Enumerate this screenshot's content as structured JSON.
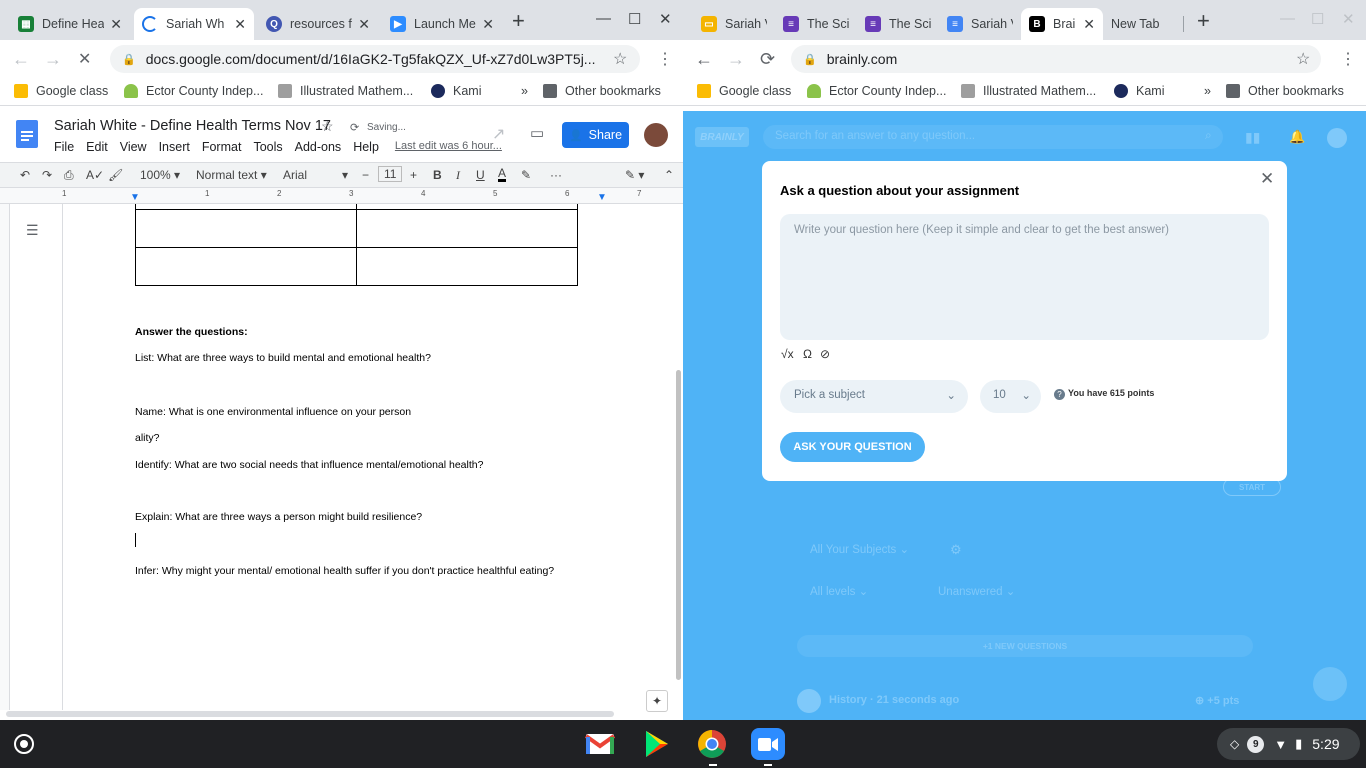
{
  "left_window": {
    "tabs": [
      {
        "title": "Define Hea",
        "icon": "sheets-icon",
        "color": "#188038"
      },
      {
        "title": "Sariah Wh",
        "icon": "loading-icon",
        "color": "#1a73e8"
      },
      {
        "title": "resources f",
        "icon": "quizlet-icon",
        "color": "#4257b2"
      },
      {
        "title": "Launch Me",
        "icon": "zoom-icon",
        "color": "#2d8cff"
      }
    ],
    "url": "docs.google.com/document/d/16IaGK2-Tg5fakQZX_Uf-xZ7d0Lw3PT5j...",
    "bookmarks": [
      "Google class",
      "Ector County Indep...",
      "Illustrated Mathem...",
      "Kami"
    ],
    "other_bookmarks": "Other bookmarks",
    "doc": {
      "title": "Sariah White - Define Health Terms Nov 17",
      "saving": "Saving...",
      "last_edit": "Last edit was 6 hour...",
      "share": "Share",
      "menu": [
        "File",
        "Edit",
        "View",
        "Insert",
        "Format",
        "Tools",
        "Add-ons",
        "Help"
      ],
      "zoom": "100%",
      "style": "Normal text",
      "font": "Arial",
      "font_size": "11",
      "ruler_numbers": [
        "1",
        "1",
        "2",
        "3",
        "4",
        "5",
        "6",
        "7"
      ],
      "heading": "Answer the questions:",
      "lines": [
        "List: What are three ways to build mental and emotional health?",
        "Name: What is one environmental influence on your person",
        "ality?",
        "Identify: What are two social needs that influence mental/emotional health?",
        "Explain: What are three ways a person might build resilience?",
        "Infer:  Why might your mental/ emotional health suffer if you don't practice healthful eating?"
      ]
    }
  },
  "right_window": {
    "tabs": [
      {
        "title": "Sariah V",
        "icon": "slides-icon",
        "color": "#f4b400"
      },
      {
        "title": "The Sci",
        "icon": "forms-icon",
        "color": "#673ab7"
      },
      {
        "title": "The Sci",
        "icon": "forms-icon",
        "color": "#673ab7"
      },
      {
        "title": "Sariah V",
        "icon": "docs-icon",
        "color": "#4285f4"
      },
      {
        "title": "Brai",
        "icon": "brainly-icon",
        "color": "#000000"
      },
      {
        "title": "New Tab",
        "icon": "",
        "color": ""
      }
    ],
    "url": "brainly.com",
    "bookmarks": [
      "Google class",
      "Ector County Indep...",
      "Illustrated Mathem...",
      "Kami"
    ],
    "other_bookmarks": "Other bookmarks",
    "brainly": {
      "logo": "BRAINLY",
      "search_placeholder": "Search for an answer to any question...",
      "modal_title": "Ask a question about your assignment",
      "question_placeholder": "Write your question here (Keep it simple and clear to get the best answer)",
      "subject_placeholder": "Pick a subject",
      "points_value": "10",
      "points_info": "You have 615 points",
      "ask_button": "ASK YOUR QUESTION",
      "start": "START",
      "filter_subjects": "All Your Subjects",
      "filter_levels": "All levels",
      "filter_status": "Unanswered",
      "new_questions": "+1 NEW QUESTIONS",
      "feed_subject": "History · 21 seconds ago",
      "feed_points": "+5 pts"
    },
    "accent": "#4fb3f6"
  },
  "taskbar": {
    "notifications": "9",
    "time": "5:29"
  }
}
